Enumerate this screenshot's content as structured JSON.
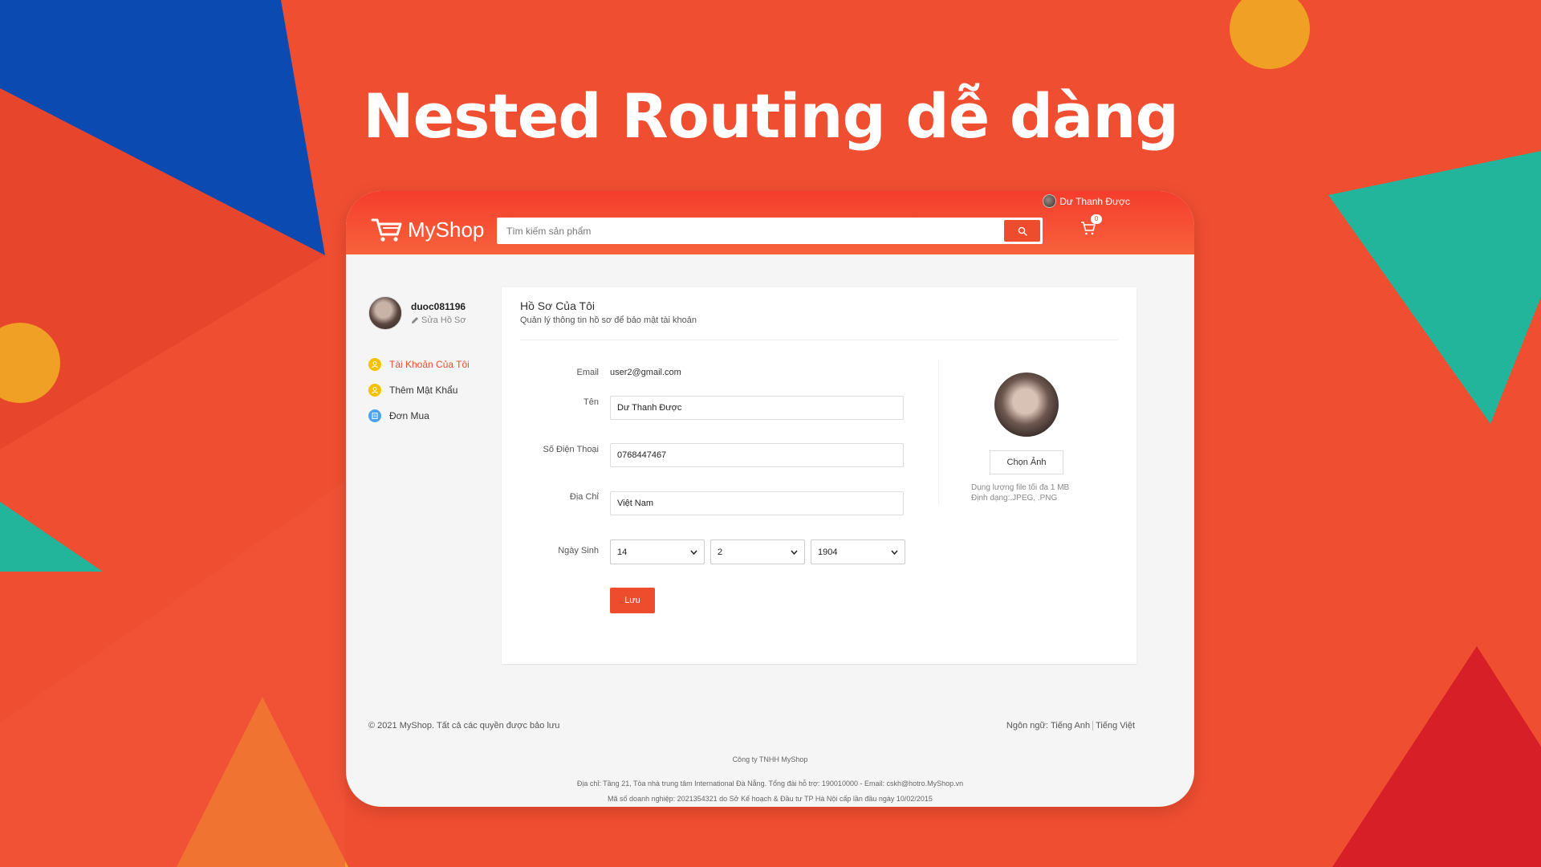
{
  "headline": "Nested Routing dễ dàng",
  "colors": {
    "accent": "#ee4d2d",
    "background": "#f04e31",
    "header_top": "#f53d2d",
    "header_bottom": "#f6623b"
  },
  "header": {
    "user_name": "Dư Thanh Được",
    "logo_text": "MyShop",
    "search_placeholder": "Tìm kiếm sản phẩm",
    "search_icon": "search-icon",
    "cart_icon": "cart-icon",
    "cart_count": "0"
  },
  "sidebar": {
    "username": "duoc081196",
    "edit_label": "Sửa Hồ Sơ",
    "items": [
      {
        "label": "Tài Khoản Của Tôi",
        "icon": "user-icon",
        "active": true
      },
      {
        "label": "Thêm Mật Khẩu",
        "icon": "user-icon",
        "active": false
      },
      {
        "label": "Đơn Mua",
        "icon": "order-icon",
        "active": false
      }
    ]
  },
  "profile": {
    "title": "Hồ Sơ Của Tôi",
    "subtitle": "Quản lý thông tin hồ sơ để bảo mật tài khoản",
    "email_label": "Email",
    "email_value": "user2@gmail.com",
    "name_label": "Tên",
    "name_value": "Dư Thanh Được",
    "phone_label": "Số Điện Thoại",
    "phone_value": "0768447467",
    "address_label": "Địa Chỉ",
    "address_value": "Việt Nam",
    "dob_label": "Ngày Sinh",
    "dob_day": "14",
    "dob_month": "2",
    "dob_year": "1904",
    "save_label": "Lưu",
    "choose_image_label": "Chọn Ảnh",
    "file_size_note": "Dụng lượng file tối đa 1 MB",
    "file_format_note": "Định dạng:.JPEG, .PNG"
  },
  "footer": {
    "copyright": "© 2021 MyShop. Tất cả các quyền được bảo lưu",
    "language_label": "Ngôn ngữ:",
    "lang_en": "Tiếng Anh",
    "lang_vi": "Tiếng Việt",
    "company": "Công ty TNHH MyShop",
    "address": "Địa chỉ: Tầng 21, Tòa nhà trung tâm International Đà Nẵng. Tổng đài hỗ trợ: 190010000 - Email: cskh@hotro.MyShop.vn",
    "business_id": "Mã số doanh nghiệp: 2021354321 do Sở Kế hoạch & Đầu tư TP Hà Nội cấp lần đầu ngày 10/02/2015"
  }
}
